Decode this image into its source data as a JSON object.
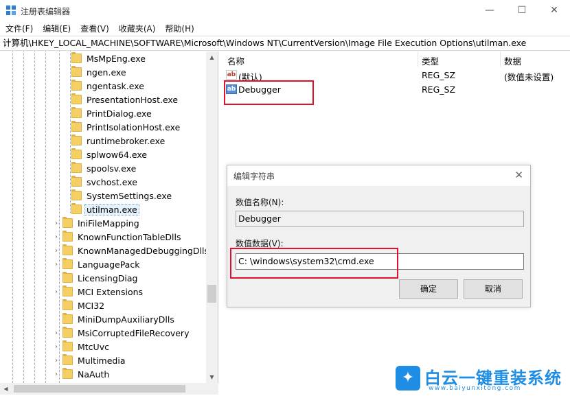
{
  "window": {
    "title": "注册表编辑器",
    "minimize": "—",
    "maximize": "☐",
    "close": "✕"
  },
  "menu": [
    "文件(F)",
    "编辑(E)",
    "查看(V)",
    "收藏夹(A)",
    "帮助(H)"
  ],
  "address": "计算机\\HKEY_LOCAL_MACHINE\\SOFTWARE\\Microsoft\\Windows NT\\CurrentVersion\\Image File Execution Options\\utilman.exe",
  "tree": {
    "children_of_ifeo": [
      "MsMpEng.exe",
      "ngen.exe",
      "ngentask.exe",
      "PresentationHost.exe",
      "PrintDialog.exe",
      "PrintIsolationHost.exe",
      "runtimebroker.exe",
      "splwow64.exe",
      "spoolsv.exe",
      "svchost.exe",
      "SystemSettings.exe",
      "utilman.exe"
    ],
    "selected": "utilman.exe",
    "siblings": [
      "IniFileMapping",
      "KnownFunctionTableDlls",
      "KnownManagedDebuggingDlls",
      "LanguagePack",
      "LicensingDiag",
      "MCI Extensions",
      "MCI32",
      "MiniDumpAuxiliaryDlls",
      "MsiCorruptedFileRecovery",
      "MtcUvc",
      "Multimedia",
      "NaAuth"
    ]
  },
  "values": {
    "headers": {
      "name": "名称",
      "type": "类型",
      "data": "数据"
    },
    "rows": [
      {
        "icon": "string-value-icon",
        "name": "(默认)",
        "type": "REG_SZ",
        "data": "(数值未设置)"
      },
      {
        "icon": "string-value-icon",
        "name": "Debugger",
        "type": "REG_SZ",
        "data": ""
      }
    ]
  },
  "dialog": {
    "title": "编辑字符串",
    "close": "✕",
    "name_label": "数值名称(N):",
    "name_value": "Debugger",
    "data_label": "数值数据(V):",
    "data_value": "C:  \\windows\\system32\\cmd.exe",
    "ok": "确定",
    "cancel": "取消"
  },
  "watermark": {
    "title": "白云一键重装系统",
    "url": "www.baiyunxitong.com"
  },
  "colors": {
    "highlight_box": "#e0102a",
    "folder": "#f4cf63",
    "watermark": "#1f8de3"
  }
}
